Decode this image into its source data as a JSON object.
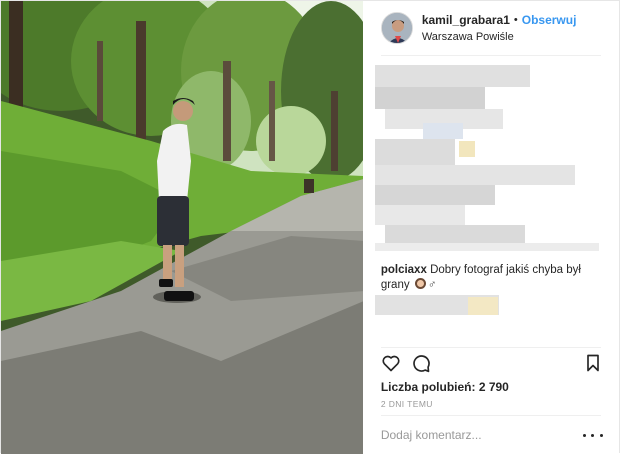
{
  "post": {
    "username": "kamil_grabara1",
    "separator": "•",
    "follow_label": "Obserwuj",
    "location": "Warszawa Powiśle"
  },
  "comments": [
    {
      "username": "",
      "text": "",
      "blurred": true
    },
    {
      "username": "polciaxx",
      "text": "Dobry fotograf jakiś chyba był grany",
      "emoji": "woman-emoji male-sign",
      "male_sign": "♂"
    }
  ],
  "actions": {
    "icons": [
      "heart-icon",
      "comment-icon",
      "bookmark-icon"
    ]
  },
  "likes_label": "Liczba polubień: 2 790",
  "timestamp": "2 DNI TEMU",
  "add_comment_placeholder": "Dodaj komentarz...",
  "colors": {
    "follow": "#3897f0",
    "text": "#262626",
    "muted": "#999999",
    "divider": "#efefef"
  }
}
